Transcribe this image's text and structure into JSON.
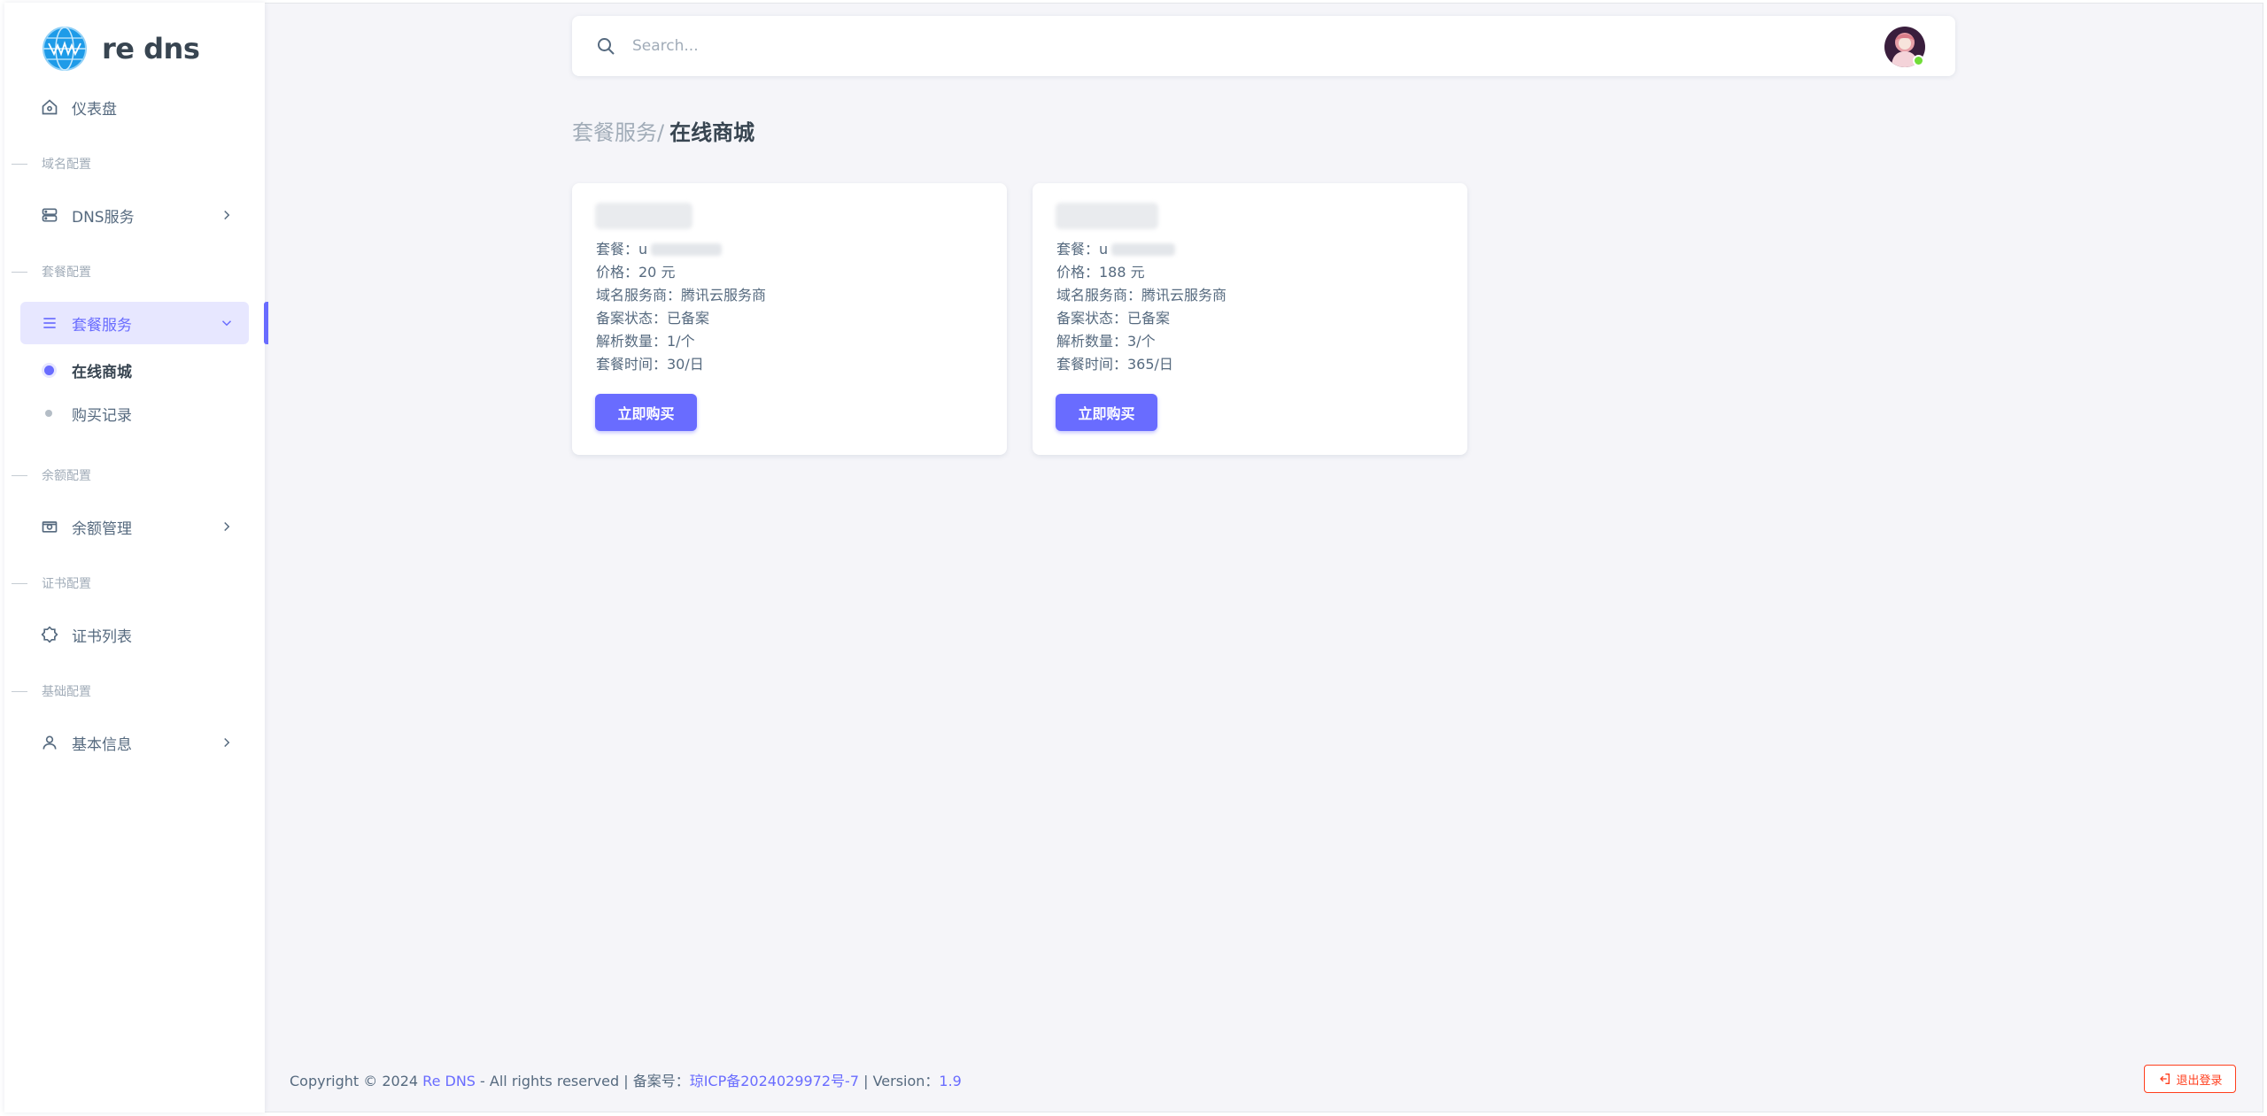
{
  "brand": {
    "name": "re dns",
    "logo_icon": "globe-icon"
  },
  "sidebar": {
    "dashboard": "仪表盘",
    "sections": {
      "domain": "域名配置",
      "package": "套餐配置",
      "balance": "余额配置",
      "cert": "证书配置",
      "basic": "基础配置"
    },
    "dns": "DNS服务",
    "package_service": "套餐服务",
    "sub_shop": "在线商城",
    "sub_records": "购买记录",
    "balance_mgmt": "余额管理",
    "cert_list": "证书列表",
    "basic_info": "基本信息"
  },
  "search": {
    "placeholder": "Search..."
  },
  "breadcrumb": {
    "parent": "套餐服务",
    "separator": "/",
    "current": "在线商城"
  },
  "cards": [
    {
      "package_label": "套餐：",
      "package_value_visible": "u",
      "price": "价格：20 元",
      "provider": "域名服务商：腾讯云服务商",
      "filing": "备案状态：已备案",
      "records": "解析数量：1/个",
      "duration": "套餐时间：30/日",
      "button": "立即购买"
    },
    {
      "package_label": "套餐：",
      "package_value_visible": "u",
      "price": "价格：188 元",
      "provider": "域名服务商：腾讯云服务商",
      "filing": "备案状态：已备案",
      "records": "解析数量：3/个",
      "duration": "套餐时间：365/日",
      "button": "立即购买"
    }
  ],
  "footer": {
    "copyright": "Copyright © 2024",
    "brand_link": "Re DNS",
    "rights": " - All rights reserved | 备案号：",
    "icp": "琼ICP备2024029972号-7",
    "version_label": " | Version：",
    "version": "1.9"
  },
  "logout": "退出登录",
  "colors": {
    "primary": "#696cff",
    "danger": "#ff3e1d",
    "online": "#71dd37"
  }
}
